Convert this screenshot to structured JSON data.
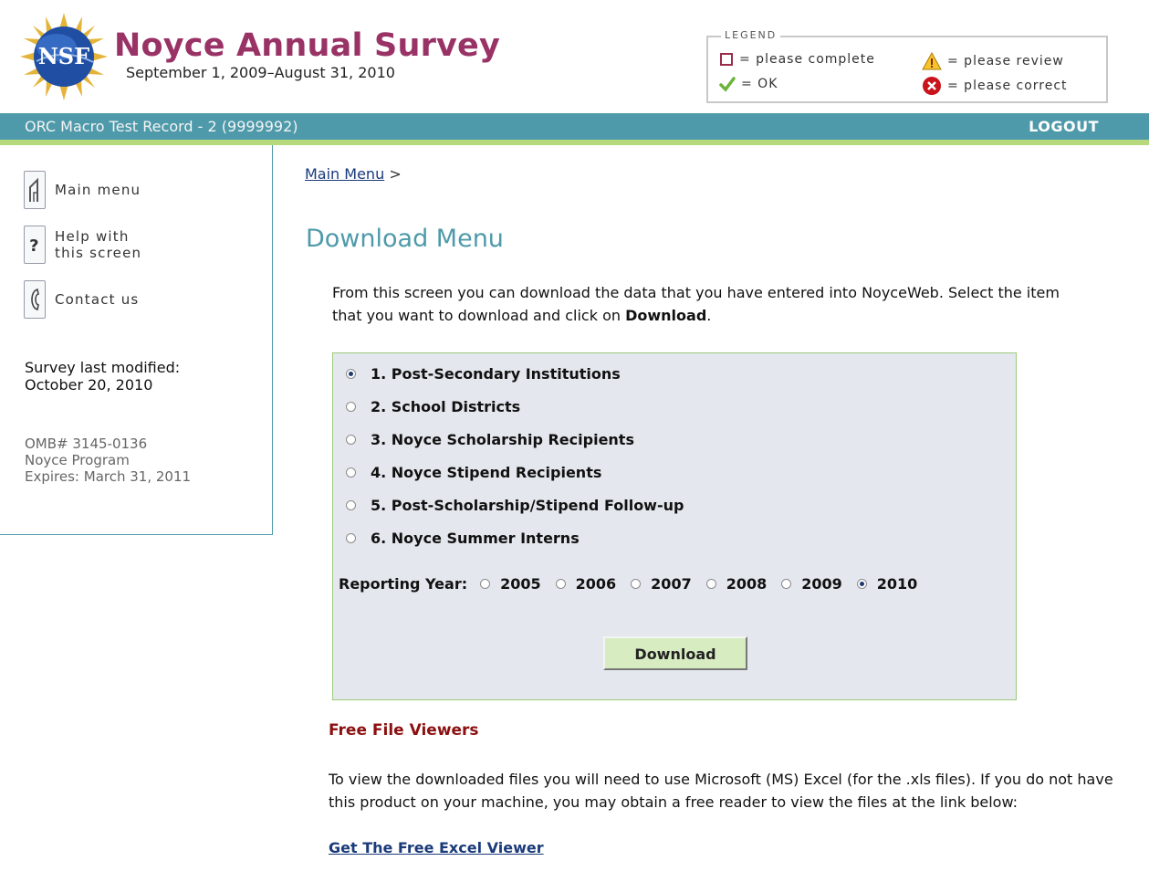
{
  "header": {
    "logo_text": "NSF",
    "title": "Noyce Annual Survey",
    "subtitle": "September 1, 2009–August 31, 2010"
  },
  "legend": {
    "title": "LEGEND",
    "items": [
      {
        "icon": "empty-square-icon",
        "label": "= please complete"
      },
      {
        "icon": "warning-icon",
        "label": "= please review"
      },
      {
        "icon": "checkmark-icon",
        "label": "= OK"
      },
      {
        "icon": "error-icon",
        "label": "= please correct"
      }
    ]
  },
  "topbar": {
    "record": "ORC Macro Test Record - 2 (9999992)",
    "logout": "LOGOUT"
  },
  "sidebar": {
    "links": [
      {
        "icon": "home-icon",
        "label": "Main menu"
      },
      {
        "icon": "help-icon",
        "label_line1": "Help with",
        "label_line2": "this screen"
      },
      {
        "icon": "phone-icon",
        "label": "Contact us"
      }
    ],
    "modified_label": "Survey last modified:",
    "modified_date": "October 20, 2010",
    "omb": "OMB# 3145-0136",
    "program": "Noyce Program",
    "expires": "Expires: March 31, 2011"
  },
  "breadcrumb": {
    "link": "Main Menu",
    "separator": ">"
  },
  "main": {
    "title": "Download Menu",
    "intro_prefix": "From this screen you can download the data that you have entered into NoyceWeb. Select the item that you want to download and click on ",
    "intro_bold": "Download",
    "intro_suffix": ".",
    "options": [
      {
        "label": "1. Post-Secondary Institutions",
        "selected": true
      },
      {
        "label": "2. School Districts",
        "selected": false
      },
      {
        "label": "3. Noyce Scholarship Recipients",
        "selected": false
      },
      {
        "label": "4. Noyce Stipend Recipients",
        "selected": false
      },
      {
        "label": "5. Post-Scholarship/Stipend Follow-up",
        "selected": false
      },
      {
        "label": "6. Noyce Summer Interns",
        "selected": false
      }
    ],
    "reporting_year_label": "Reporting Year:",
    "years": [
      "2005",
      "2006",
      "2007",
      "2008",
      "2009",
      "2010"
    ],
    "selected_year": "2010",
    "download_button": "Download"
  },
  "viewers": {
    "title": "Free File Viewers",
    "text": "To view the downloaded files you will need to use Microsoft (MS) Excel (for the .xls files). If you do not have this product on your machine, you may obtain a free reader to view the files at the link below:",
    "link": "Get The Free Excel Viewer"
  },
  "colors": {
    "brand_purple": "#993366",
    "teal": "#4e9aaa",
    "green_stripe": "#b5d97b",
    "heading_red": "#8b1010"
  }
}
